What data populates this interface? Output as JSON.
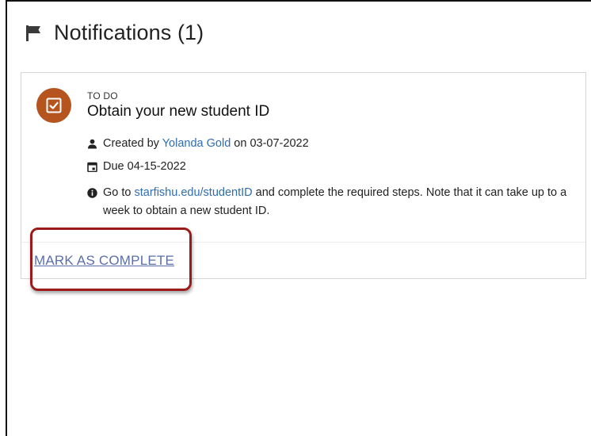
{
  "header": {
    "title": "Notifications (1)",
    "icon": "flag-icon"
  },
  "notification": {
    "category": "TO DO",
    "title": "Obtain your new student ID",
    "created_prefix": "Created by",
    "creator": "Yolanda Gold",
    "created_on_word": "on",
    "created_date": "03-07-2022",
    "due_text": "Due 04-15-2022",
    "note_prefix": "Go to",
    "note_link": "starfishu.edu/studentID",
    "note_suffix": "and complete the required steps. Note that it can take up to a week to obtain a new student ID.",
    "action_label": "MARK AS COMPLETE"
  },
  "colors": {
    "todo_icon_bg": "#b5541f",
    "link": "#2f6db3",
    "action_link": "#5a6ea8",
    "highlight_border": "#9b1b1b"
  }
}
